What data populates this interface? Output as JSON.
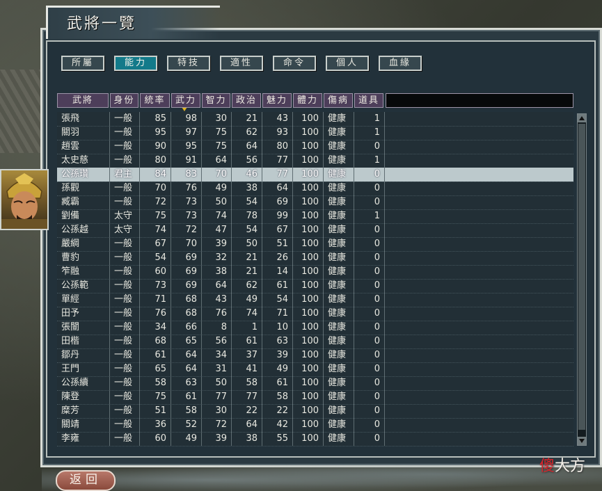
{
  "window": {
    "title": "武將一覽"
  },
  "tabs": [
    {
      "label": "所屬",
      "active": false
    },
    {
      "label": "能力",
      "active": true
    },
    {
      "label": "特技",
      "active": false
    },
    {
      "label": "適性",
      "active": false
    },
    {
      "label": "命令",
      "active": false
    },
    {
      "label": "個人",
      "active": false
    },
    {
      "label": "血緣",
      "active": false
    }
  ],
  "table": {
    "headers": [
      "武將",
      "身份",
      "統率",
      "武力",
      "智力",
      "政治",
      "魅力",
      "體力",
      "傷病",
      "道具"
    ],
    "sorted_column": "武力",
    "selected_row": 4,
    "rows": [
      [
        "張飛",
        "一般",
        "85",
        "98",
        "30",
        "21",
        "43",
        "100",
        "健康",
        "1"
      ],
      [
        "關羽",
        "一般",
        "95",
        "97",
        "75",
        "62",
        "93",
        "100",
        "健康",
        "1"
      ],
      [
        "趙雲",
        "一般",
        "90",
        "95",
        "75",
        "64",
        "80",
        "100",
        "健康",
        "0"
      ],
      [
        "太史慈",
        "一般",
        "80",
        "91",
        "64",
        "56",
        "77",
        "100",
        "健康",
        "1"
      ],
      [
        "公孫瓚",
        "君主",
        "84",
        "83",
        "70",
        "46",
        "77",
        "100",
        "健康",
        "0"
      ],
      [
        "孫觀",
        "一般",
        "70",
        "76",
        "49",
        "38",
        "64",
        "100",
        "健康",
        "0"
      ],
      [
        "臧霸",
        "一般",
        "72",
        "73",
        "50",
        "54",
        "69",
        "100",
        "健康",
        "0"
      ],
      [
        "劉備",
        "太守",
        "75",
        "73",
        "74",
        "78",
        "99",
        "100",
        "健康",
        "1"
      ],
      [
        "公孫越",
        "太守",
        "74",
        "72",
        "47",
        "54",
        "67",
        "100",
        "健康",
        "0"
      ],
      [
        "嚴綱",
        "一般",
        "67",
        "70",
        "39",
        "50",
        "51",
        "100",
        "健康",
        "0"
      ],
      [
        "曹豹",
        "一般",
        "54",
        "69",
        "32",
        "21",
        "26",
        "100",
        "健康",
        "0"
      ],
      [
        "笮融",
        "一般",
        "60",
        "69",
        "38",
        "21",
        "14",
        "100",
        "健康",
        "0"
      ],
      [
        "公孫範",
        "一般",
        "73",
        "69",
        "64",
        "62",
        "61",
        "100",
        "健康",
        "0"
      ],
      [
        "單經",
        "一般",
        "71",
        "68",
        "43",
        "49",
        "54",
        "100",
        "健康",
        "0"
      ],
      [
        "田予",
        "一般",
        "76",
        "68",
        "76",
        "74",
        "71",
        "100",
        "健康",
        "0"
      ],
      [
        "張闓",
        "一般",
        "34",
        "66",
        "8",
        "1",
        "10",
        "100",
        "健康",
        "0"
      ],
      [
        "田楷",
        "一般",
        "68",
        "65",
        "56",
        "61",
        "63",
        "100",
        "健康",
        "0"
      ],
      [
        "鄒丹",
        "一般",
        "61",
        "64",
        "34",
        "37",
        "39",
        "100",
        "健康",
        "0"
      ],
      [
        "王門",
        "一般",
        "65",
        "64",
        "31",
        "41",
        "49",
        "100",
        "健康",
        "0"
      ],
      [
        "公孫續",
        "一般",
        "58",
        "63",
        "50",
        "58",
        "61",
        "100",
        "健康",
        "0"
      ],
      [
        "陳登",
        "一般",
        "75",
        "61",
        "77",
        "77",
        "58",
        "100",
        "健康",
        "0"
      ],
      [
        "糜芳",
        "一般",
        "51",
        "58",
        "30",
        "22",
        "22",
        "100",
        "健康",
        "0"
      ],
      [
        "關靖",
        "一般",
        "36",
        "52",
        "72",
        "64",
        "42",
        "100",
        "健康",
        "0"
      ],
      [
        "李雍",
        "一般",
        "60",
        "49",
        "39",
        "38",
        "55",
        "100",
        "健康",
        "0"
      ]
    ]
  },
  "footer": {
    "back_label": "返回"
  },
  "watermark": {
    "highlight": "傻",
    "rest": "大方"
  },
  "icons": {
    "portrait": "general-portrait",
    "scroll_up": "up-arrow-icon",
    "scroll_down": "down-arrow-icon",
    "sort": "sort-indicator-icon"
  }
}
